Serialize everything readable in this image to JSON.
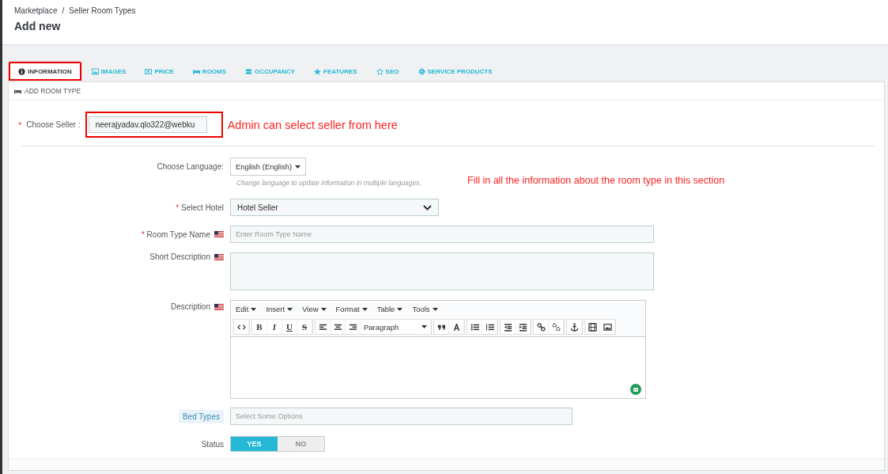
{
  "breadcrumb": [
    "Marketplace",
    "Seller Room Types"
  ],
  "breadcrumb_separator": "/",
  "title": "Add new",
  "tabs": [
    {
      "label": "INFORMATION",
      "selected": true,
      "annotated": true
    },
    {
      "label": "IMAGES",
      "selected": false,
      "annotated": false
    },
    {
      "label": "PRICE",
      "selected": false,
      "annotated": false
    },
    {
      "label": "ROOMS",
      "selected": false,
      "annotated": false
    },
    {
      "label": "OCCUPANCY",
      "selected": false,
      "annotated": false
    },
    {
      "label": "FEATURES",
      "selected": false,
      "annotated": false
    },
    {
      "label": "SEO",
      "selected": false,
      "annotated": false
    },
    {
      "label": "SERVICE PRODUCTS",
      "selected": false,
      "annotated": false
    }
  ],
  "panel_title": "ADD ROOM TYPE",
  "seller": {
    "label": "Choose Seller :",
    "required_mark": "*",
    "value": "neerajyadav.qlo322@webku",
    "annotated": true,
    "note": "Admin can select seller from here"
  },
  "language": {
    "label": "Choose Language:",
    "value": "English (English)",
    "help": "Change language to update information in multiple languages.",
    "note": "Fill in all the information about the room type in this section"
  },
  "hotel": {
    "label": "Select Hotel",
    "required_mark": "*",
    "value": "Hotel Seller"
  },
  "room_type_name": {
    "label": "Room Type Name",
    "required_mark": "*",
    "placeholder": "Enter Room Type Name"
  },
  "short_description": {
    "label": "Short Description"
  },
  "description": {
    "label": "Description",
    "menus": [
      "Edit",
      "Insert",
      "View",
      "Format",
      "Table",
      "Tools"
    ],
    "format_buttons": [
      "B",
      "I",
      "U",
      "S"
    ],
    "block_format": "Paragraph"
  },
  "bed_types": {
    "label": "Bed Types",
    "placeholder": "Select Some Options"
  },
  "status": {
    "label": "Status",
    "options": [
      {
        "label": "YES",
        "selected": true
      },
      {
        "label": "NO",
        "selected": false
      }
    ]
  }
}
